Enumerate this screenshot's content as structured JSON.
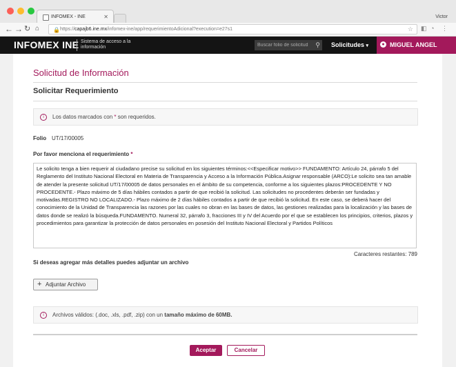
{
  "browser": {
    "tab_title": "INFOMEX - INE",
    "user_name": "Victor",
    "url_protocol": "https://",
    "url_host": "capajb6.ine.mx",
    "url_path": "/infomex-ine/app/requerimientoAdicional?execution=e27s1"
  },
  "header": {
    "logo": "INFOMEX INE",
    "logo_subtitle": "Sistema de acceso a la información",
    "search_placeholder": "Buscar folio de solicitud",
    "solicitudes_label": "Solicitudes",
    "user_label": "MIGUEL ANGEL"
  },
  "page": {
    "title": "Solicitud de Información",
    "subtitle": "Solicitar Requerimiento",
    "required_note_prefix": "Los datos marcados con ",
    "required_note_star": "*",
    "required_note_suffix": " son requeridos.",
    "folio_label": "Folio",
    "folio_value": "UT/17/00005",
    "requirement_label": "Por favor menciona el requerimiento",
    "requirement_star": "*",
    "requirement_text": "Le solicito tenga a bien requerir al ciudadano precise su solicitud en los siguientes términos:<<Especificar motivo>> FUNDAMENTO: Artículo 24, párrafo 5 del Reglamento del Instituto Nacional Electoral en Materia de Transparencia y Acceso a la Información Pública.Asignar responsable (ARCO):Le solicito sea tan amable de atender la presente solicitud UT/17/00005 de datos personales en el ámbito de su competencia, conforme a los siguientes plazos:PROCEDENTE Y NO PROCEDENTE.- Plazo máximo de 5 días hábiles contados a partir de que recibió la solicitud. Las solicitudes no procedentes deberán ser fundadas y motivadas.REGISTRO NO LOCALIZADO.- Plazo máximo de 2 días hábiles contados a partir de que recibió la solicitud. En este caso, se deberá hacer del conocimiento de la Unidad de Transparencia las razones por las cuales no obran en las bases de datos, las gestiones realizadas para la localización y las bases de datos donde se realizó la búsqueda.FUNDAMENTO. Numeral 32, párrafo 3, fracciones III y IV del Acuerdo por el que se establecen los principios, criterios, plazos y procedimientos para garantizar la protección de datos personales en posesión del Instituto Nacional Electoral y Partidos Políticos",
    "chars_remaining": "Caracteres restantes: 789",
    "attach_prompt": "Si deseas agregar más detalles puedes adjuntar un archivo",
    "attach_button": "Adjuntar Archivo",
    "valid_files_prefix": "Archivos válidos: (.doc, .xls, .pdf, .zip) con un ",
    "valid_files_bold": "tamaño máximo de 60MB.",
    "accept_button": "Aceptar",
    "cancel_button": "Cancelar"
  },
  "colors": {
    "accent": "#a3195b",
    "header_bg": "#141414"
  }
}
